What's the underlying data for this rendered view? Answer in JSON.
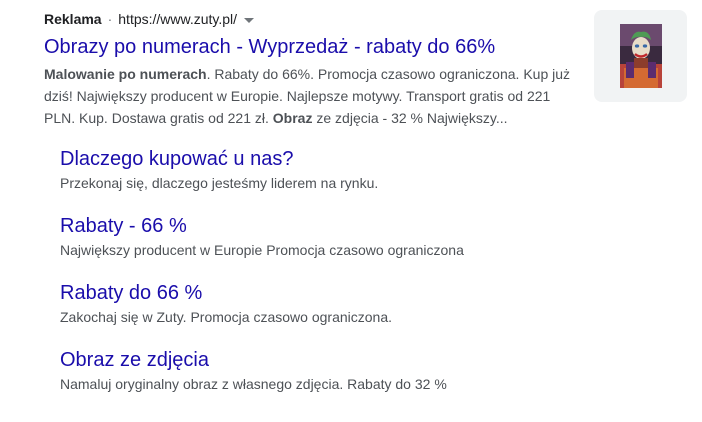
{
  "ad": {
    "label": "Reklama",
    "separator": "·",
    "url": "https://www.zuty.pl/",
    "menu_icon": "caret-down-icon",
    "title": "Obrazy po numerach - Wyprzedaż - rabaty do 66%",
    "description": {
      "bold_1": "Malowanie po numerach",
      "text_1": ". Rabaty do 66%. Promocja czasowo ograniczona. Kup już dziś! Największy producent w Europie. Najlepsze motywy. Transport gratis od 221 PLN. Kup. Dostawa gratis od 221 zł. ",
      "bold_2": "Obraz",
      "text_2": " ze zdjęcia - 32 % Największy..."
    },
    "thumbnail_icon": "joker-painting-thumbnail"
  },
  "sitelinks": [
    {
      "title": "Dlaczego kupować u nas?",
      "description": "Przekonaj się, dlaczego jesteśmy liderem na rynku."
    },
    {
      "title": "Rabaty - 66 %",
      "description": "Największy producent w Europie Promocja czasowo ograniczona"
    },
    {
      "title": "Rabaty do 66 %",
      "description": "Zakochaj się w Zuty. Promocja czasowo ograniczona."
    },
    {
      "title": "Obraz ze zdjęcia",
      "description": "Namaluj oryginalny obraz z własnego zdjęcia. Rabaty do 32 %"
    }
  ],
  "colors": {
    "link": "#1a0dab",
    "text": "#4d5156",
    "dark_text": "#202124",
    "thumbnail_bg": "#f1f3f4"
  }
}
